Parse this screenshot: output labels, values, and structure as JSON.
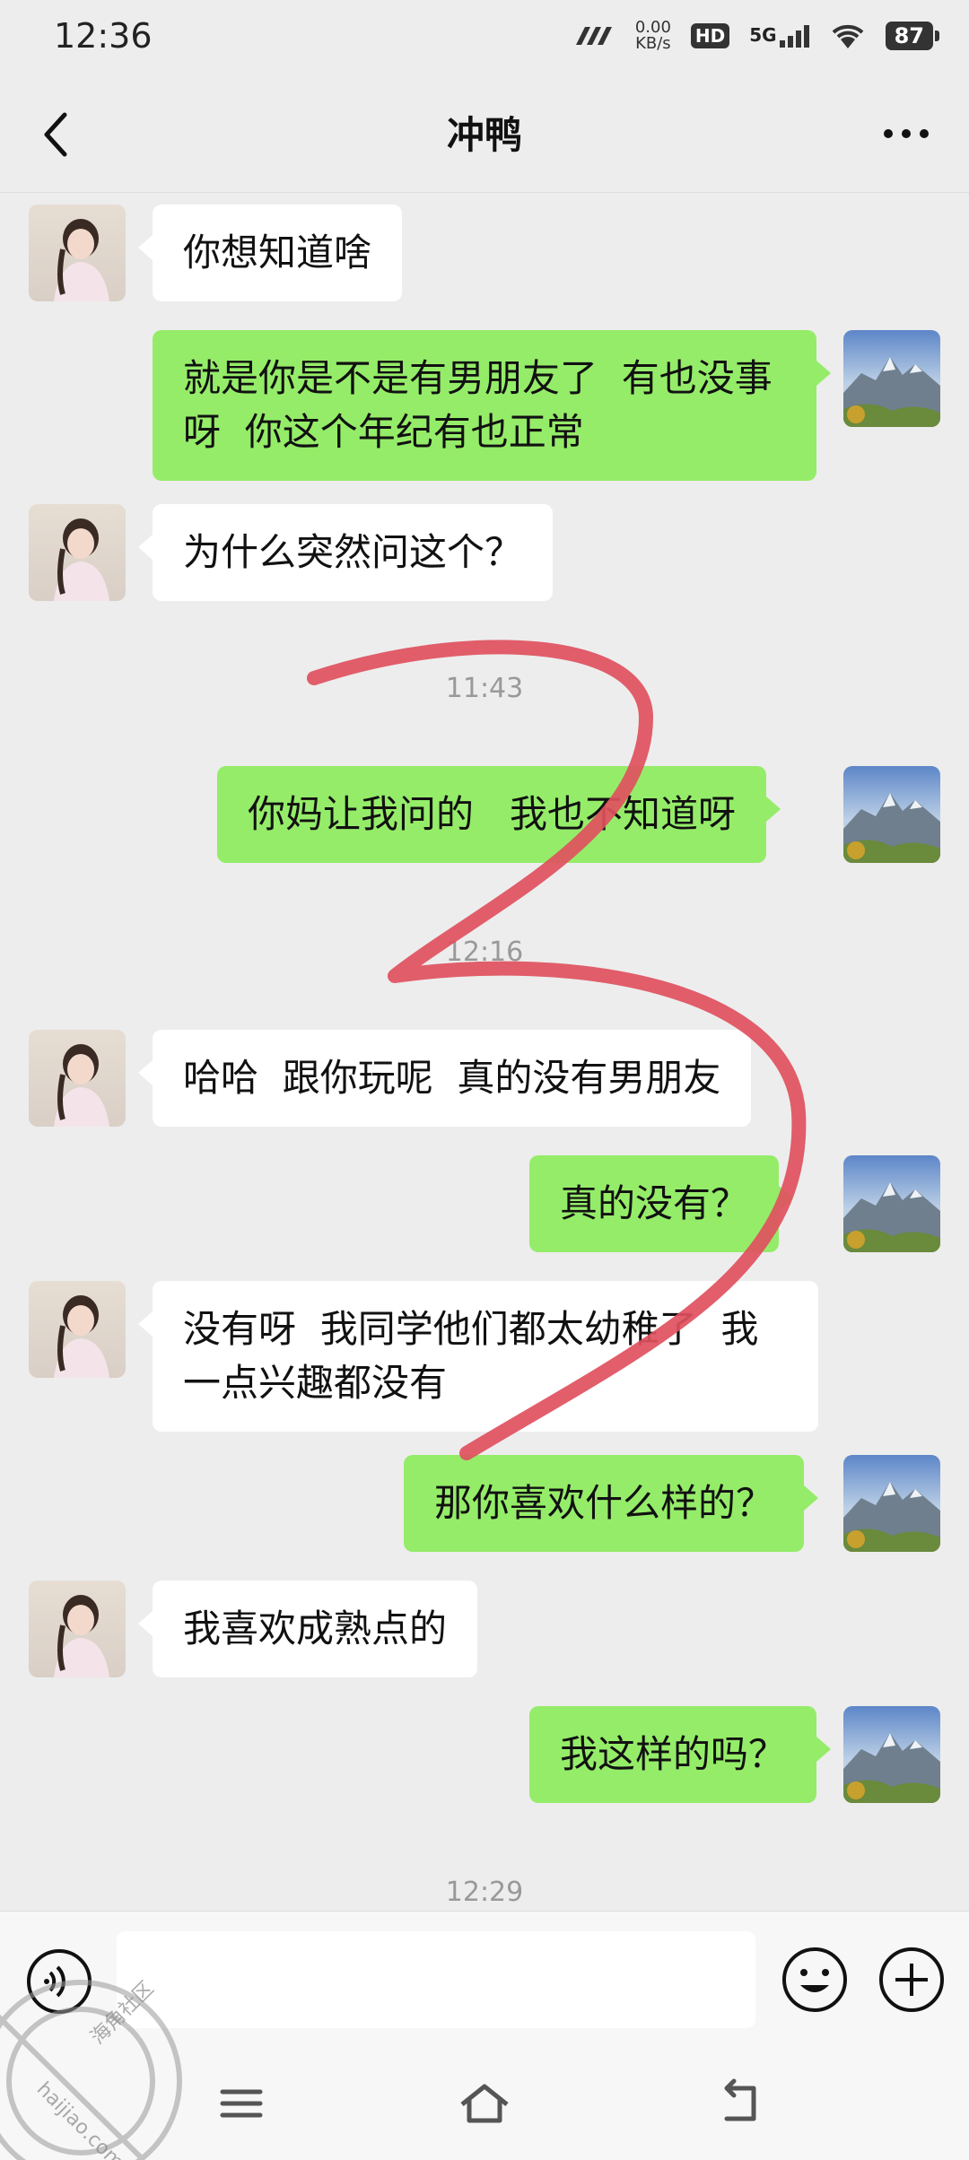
{
  "status_bar": {
    "time": "12:36",
    "net_speed_value": "0.00",
    "net_speed_unit": "KB/s",
    "hd_label": "HD",
    "network_label": "5G",
    "battery": "87"
  },
  "header": {
    "title": "冲鸭"
  },
  "messages": [
    {
      "side": "left",
      "text": "你想知道啥"
    },
    {
      "side": "right",
      "text": "就是你是不是有男朋友了  有也没事呀  你这个年纪有也正常"
    },
    {
      "side": "left",
      "text": "为什么突然问这个？"
    },
    {
      "side": "right",
      "text": "你妈让我问的   我也不知道呀"
    },
    {
      "side": "left",
      "text": "哈哈  跟你玩呢  真的没有男朋友"
    },
    {
      "side": "right",
      "text": "真的没有？"
    },
    {
      "side": "left",
      "text": "没有呀  我同学他们都太幼稚了  我一点兴趣都没有"
    },
    {
      "side": "right",
      "text": "那你喜欢什么样的？"
    },
    {
      "side": "left",
      "text": "我喜欢成熟点的"
    },
    {
      "side": "right",
      "text": "我这样的吗？"
    }
  ],
  "timestamps": [
    "11:43",
    "12:16",
    "12:29"
  ],
  "input": {
    "placeholder": ""
  },
  "watermark": {
    "text_main": "海角社区",
    "text_url": "haijiao.com"
  },
  "colors": {
    "background": "#ededed",
    "bubble_sent": "#95ec69",
    "bubble_received": "#ffffff",
    "scribble": "#e0505e"
  }
}
